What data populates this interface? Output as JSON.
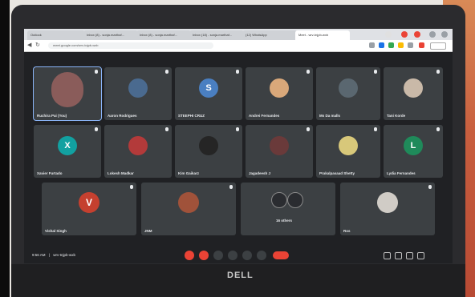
{
  "browser": {
    "tabs": [
      {
        "label": "Outlook"
      },
      {
        "label": "Inbox (8) - sonja.marthaf..."
      },
      {
        "label": "Inbox (8) - sonja.marthaf..."
      },
      {
        "label": "Inbox (18) - sonja.marthaf..."
      },
      {
        "label": "(12) WhatsApp"
      },
      {
        "label": "Meet - wrv-tnjpb-wxb"
      }
    ],
    "url": "meet.google.com/wrv-tnjpb-wxb"
  },
  "meeting": {
    "participants": [
      {
        "name": "Ruchira Pai (You)",
        "initial": "",
        "avatar_color": "#8a5c5a",
        "type": "video"
      },
      {
        "name": "Aaron Rodrigues",
        "initial": "",
        "avatar_color": "#4a6a8f",
        "type": "photo"
      },
      {
        "name": "STEEPHI CRUZ",
        "initial": "S",
        "avatar_color": "#4a7fc1",
        "type": "letter"
      },
      {
        "name": "Andrei Fernandes",
        "initial": "",
        "avatar_color": "#d9a87a",
        "type": "photo"
      },
      {
        "name": "Ms Da malls",
        "initial": "",
        "avatar_color": "#5a6770",
        "type": "photo"
      },
      {
        "name": "Tani Korde",
        "initial": "",
        "avatar_color": "#c9b9a8",
        "type": "photo"
      },
      {
        "name": "Xavier Furtado",
        "initial": "X",
        "avatar_color": "#12a1a1",
        "type": "letter"
      },
      {
        "name": "Lokesh Madkar",
        "initial": "",
        "avatar_color": "#b33a3a",
        "type": "photo"
      },
      {
        "name": "Kim Gaikarz",
        "initial": "",
        "avatar_color": "#252525",
        "type": "photo"
      },
      {
        "name": "Jagadeesh J",
        "initial": "",
        "avatar_color": "#6a3a3a",
        "type": "photo"
      },
      {
        "name": "Prakalpasaad Shetty",
        "initial": "",
        "avatar_color": "#d8c87a",
        "type": "photo"
      },
      {
        "name": "Lydia Fernandes",
        "initial": "L",
        "avatar_color": "#1f8a5a",
        "type": "letter"
      },
      {
        "name": "Vishal Singh",
        "initial": "V",
        "avatar_color": "#c5402f",
        "type": "letter"
      },
      {
        "name": "JNM",
        "initial": "",
        "avatar_color": "#a0523a",
        "type": "photo"
      },
      {
        "name": "16 others",
        "initial": "",
        "avatar_color": "#4a4d52",
        "type": "group"
      },
      {
        "name": "Ros",
        "initial": "",
        "avatar_color": "#d0ccc6",
        "type": "photo"
      }
    ],
    "time": "9:56 AM",
    "meeting_code": "wrv-tnjpb-wxb"
  },
  "laptop": {
    "brand": "DELL"
  },
  "colors": {
    "end_call": "#ea4335",
    "control_red": "#ea4335",
    "background": "#202124",
    "tile": "#3c4043"
  }
}
